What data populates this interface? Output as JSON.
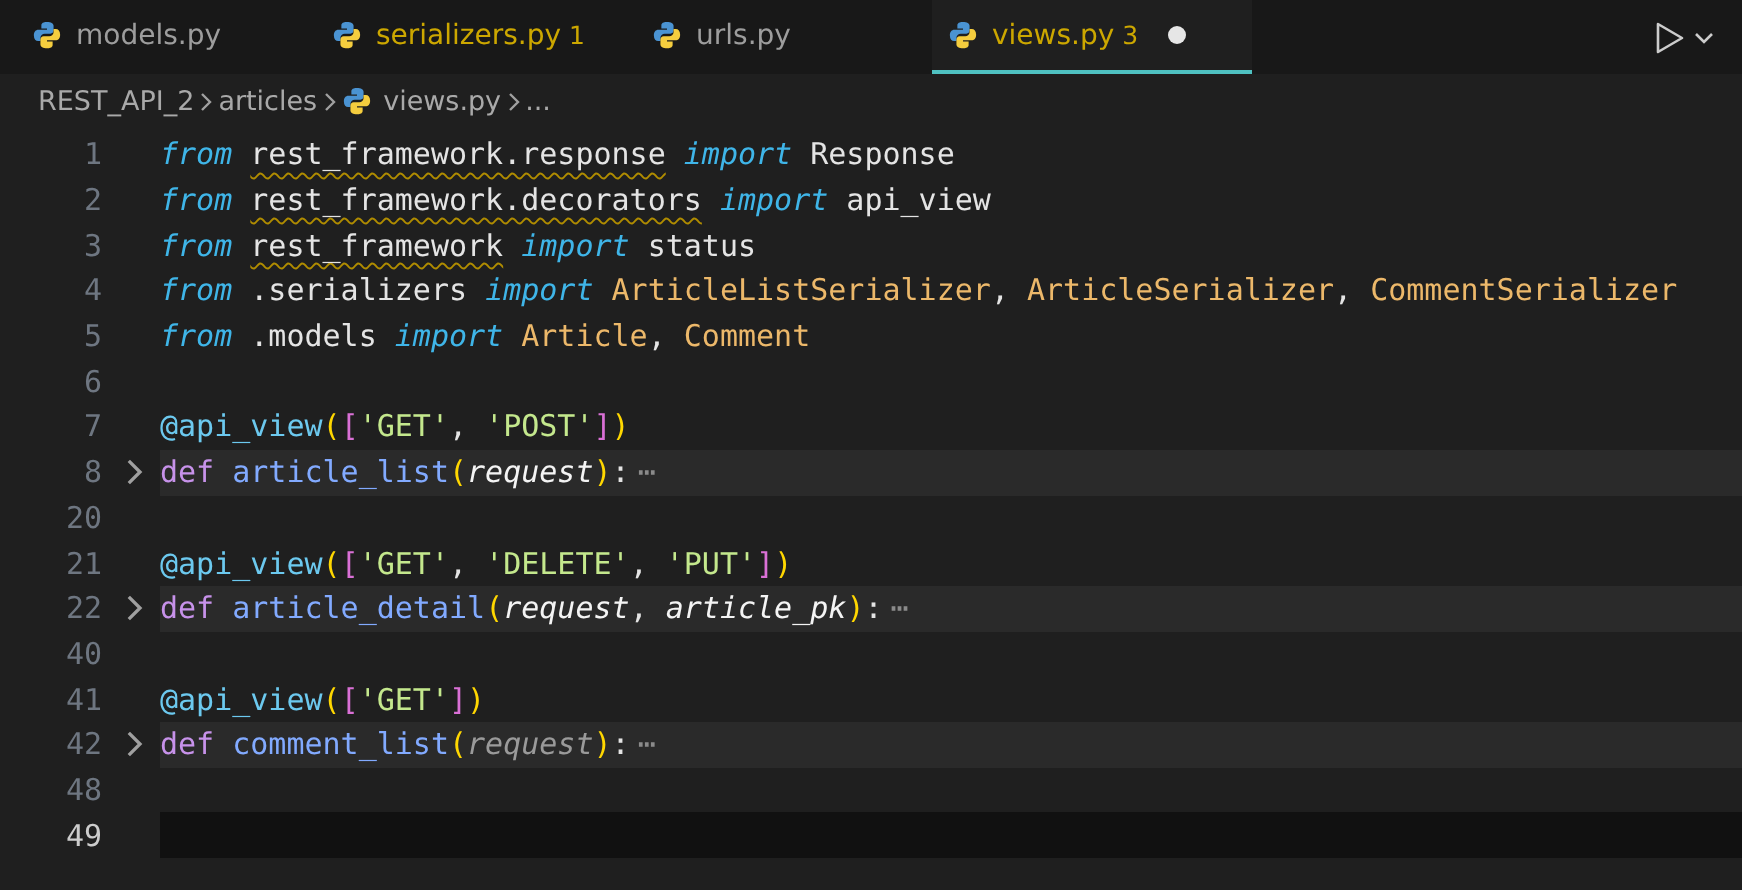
{
  "tabs": [
    {
      "label": "models.py",
      "has_problems": false,
      "modified": false,
      "selected": false
    },
    {
      "label": "serializers.py",
      "badge": "1",
      "has_problems": true,
      "modified": false,
      "selected": false
    },
    {
      "label": "urls.py",
      "has_problems": false,
      "modified": false,
      "selected": false
    },
    {
      "label": "views.py",
      "badge": "3",
      "has_problems": true,
      "modified": true,
      "selected": true
    }
  ],
  "breadcrumbs": [
    {
      "label": "REST_API_2",
      "kind": "folder"
    },
    {
      "label": "articles",
      "kind": "folder"
    },
    {
      "label": "views.py",
      "kind": "python-file"
    },
    {
      "label": "...",
      "kind": "more"
    }
  ],
  "lines": [
    {
      "number": "1",
      "folded": false,
      "current": false,
      "tokens": [
        {
          "text": "from ",
          "kind": "kw"
        },
        {
          "text": "rest_framework.response",
          "kind": "module-warning"
        },
        {
          "text": " import",
          "kind": "kw"
        },
        {
          "text": " Response",
          "kind": "plain"
        }
      ]
    },
    {
      "number": "2",
      "folded": false,
      "current": false,
      "tokens": [
        {
          "text": "from ",
          "kind": "kw"
        },
        {
          "text": "rest_framework.decorators",
          "kind": "module-warning"
        },
        {
          "text": " import",
          "kind": "kw"
        },
        {
          "text": " api_view",
          "kind": "plain"
        }
      ]
    },
    {
      "number": "3",
      "folded": false,
      "current": false,
      "tokens": [
        {
          "text": "from ",
          "kind": "kw"
        },
        {
          "text": "rest_framework",
          "kind": "module-warning"
        },
        {
          "text": " import",
          "kind": "kw"
        },
        {
          "text": " status",
          "kind": "plain"
        }
      ]
    },
    {
      "number": "4",
      "folded": false,
      "current": false,
      "tokens": [
        {
          "text": "from",
          "kind": "kw"
        },
        {
          "text": " .serializers ",
          "kind": "plain"
        },
        {
          "text": "import ",
          "kind": "kw"
        },
        {
          "text": "ArticleListSerializer",
          "kind": "class"
        },
        {
          "text": ", ",
          "kind": "plain"
        },
        {
          "text": "ArticleSerializer",
          "kind": "class"
        },
        {
          "text": ", ",
          "kind": "plain"
        },
        {
          "text": "CommentSerializer",
          "kind": "class"
        }
      ]
    },
    {
      "number": "5",
      "folded": false,
      "current": false,
      "tokens": [
        {
          "text": "from",
          "kind": "kw"
        },
        {
          "text": " .models ",
          "kind": "plain"
        },
        {
          "text": "import ",
          "kind": "kw"
        },
        {
          "text": "Article",
          "kind": "class"
        },
        {
          "text": ", ",
          "kind": "plain"
        },
        {
          "text": "Comment",
          "kind": "class"
        }
      ]
    },
    {
      "number": "6",
      "folded": false,
      "current": false
    },
    {
      "number": "7",
      "folded": false,
      "current": false,
      "tokens": [
        {
          "text": "@api_view",
          "kind": "decorator"
        },
        {
          "text": "(",
          "kind": "bracket1"
        },
        {
          "text": "[",
          "kind": "bracket2"
        },
        {
          "text": "'GET'",
          "kind": "string"
        },
        {
          "text": ", ",
          "kind": "plain"
        },
        {
          "text": "'POST'",
          "kind": "string"
        },
        {
          "text": "]",
          "kind": "bracket2"
        },
        {
          "text": ")",
          "kind": "bracket1"
        }
      ]
    },
    {
      "number": "8",
      "folded": true,
      "current": false,
      "tokens": [
        {
          "text": "def ",
          "kind": "def"
        },
        {
          "text": "article_list",
          "kind": "function"
        },
        {
          "text": "(",
          "kind": "bracket1"
        },
        {
          "text": "request",
          "kind": "param"
        },
        {
          "text": ")",
          "kind": "bracket1"
        },
        {
          "text": ":",
          "kind": "plain"
        },
        {
          "text": "⋯",
          "kind": "fold"
        }
      ]
    },
    {
      "number": "20",
      "folded": false,
      "current": false
    },
    {
      "number": "21",
      "folded": false,
      "current": false,
      "tokens": [
        {
          "text": "@api_view",
          "kind": "decorator"
        },
        {
          "text": "(",
          "kind": "bracket1"
        },
        {
          "text": "[",
          "kind": "bracket2"
        },
        {
          "text": "'GET'",
          "kind": "string"
        },
        {
          "text": ", ",
          "kind": "plain"
        },
        {
          "text": "'DELETE'",
          "kind": "string"
        },
        {
          "text": ", ",
          "kind": "plain"
        },
        {
          "text": "'PUT'",
          "kind": "string"
        },
        {
          "text": "]",
          "kind": "bracket2"
        },
        {
          "text": ")",
          "kind": "bracket1"
        }
      ]
    },
    {
      "number": "22",
      "folded": true,
      "current": false,
      "tokens": [
        {
          "text": "def ",
          "kind": "def"
        },
        {
          "text": "article_detail",
          "kind": "function"
        },
        {
          "text": "(",
          "kind": "bracket1"
        },
        {
          "text": "request",
          "kind": "param"
        },
        {
          "text": ", ",
          "kind": "plain"
        },
        {
          "text": "article_pk",
          "kind": "param"
        },
        {
          "text": ")",
          "kind": "bracket1"
        },
        {
          "text": ":",
          "kind": "plain"
        },
        {
          "text": "⋯",
          "kind": "fold"
        }
      ]
    },
    {
      "number": "40",
      "folded": false,
      "current": false
    },
    {
      "number": "41",
      "folded": false,
      "current": false,
      "tokens": [
        {
          "text": "@api_view",
          "kind": "decorator"
        },
        {
          "text": "(",
          "kind": "bracket1"
        },
        {
          "text": "[",
          "kind": "bracket2"
        },
        {
          "text": "'GET'",
          "kind": "string"
        },
        {
          "text": "]",
          "kind": "bracket2"
        },
        {
          "text": ")",
          "kind": "bracket1"
        }
      ]
    },
    {
      "number": "42",
      "folded": true,
      "current": false,
      "tokens": [
        {
          "text": "def ",
          "kind": "def"
        },
        {
          "text": "comment_list",
          "kind": "function"
        },
        {
          "text": "(",
          "kind": "bracket1"
        },
        {
          "text": "request",
          "kind": "param-unused"
        },
        {
          "text": ")",
          "kind": "bracket1"
        },
        {
          "text": ":",
          "kind": "plain"
        },
        {
          "text": "⋯",
          "kind": "fold"
        }
      ]
    },
    {
      "number": "48",
      "folded": false,
      "current": false
    },
    {
      "number": "49",
      "folded": false,
      "current": true
    }
  ]
}
